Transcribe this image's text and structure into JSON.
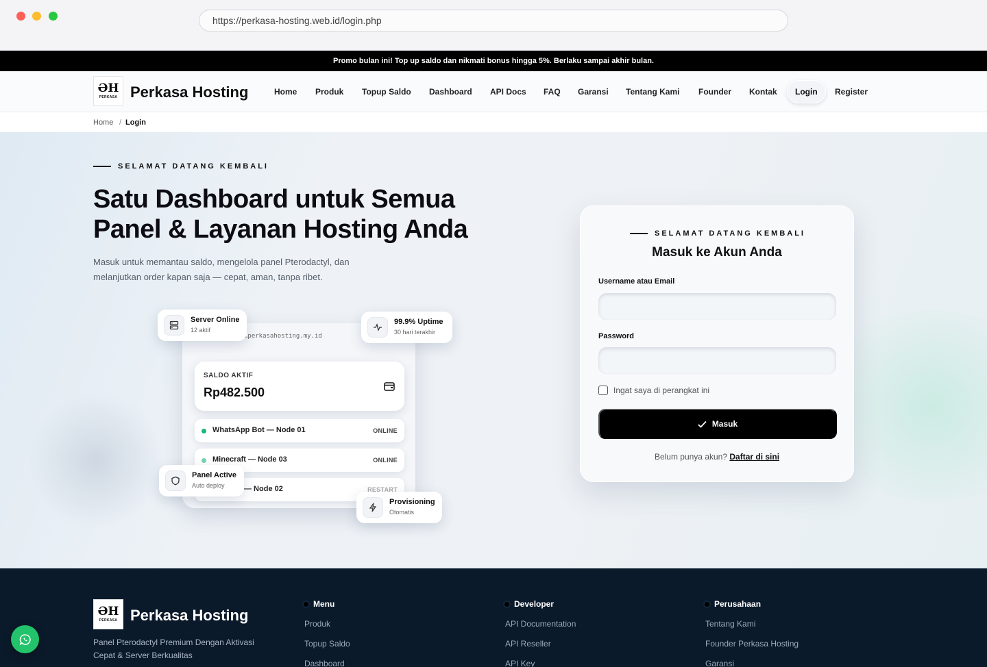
{
  "browser": {
    "url": "https://perkasa-hosting.web.id/login.php"
  },
  "promo": "Promo bulan ini! Top up saldo dan nikmati bonus hingga 5%. Berlaku sampai akhir bulan.",
  "brand": {
    "name": "Perkasa Hosting",
    "logo_mark": "ƏH",
    "logo_sub": "PERKASA"
  },
  "nav": {
    "home": "Home",
    "produk": "Produk",
    "topup": "Topup Saldo",
    "dashboard": "Dashboard",
    "api": "API Docs",
    "faq": "FAQ",
    "garansi": "Garansi",
    "tentang": "Tentang Kami",
    "founder": "Founder",
    "kontak": "Kontak",
    "login": "Login",
    "register": "Register"
  },
  "breadcrumb": {
    "home": "Home",
    "sep": "/",
    "current": "Login"
  },
  "hero": {
    "eyebrow": "SELAMAT DATANG KEMBALI",
    "title": "Satu Dashboard untuk Semua Panel & Layanan Hosting Anda",
    "desc": "Masuk untuk memantau saldo, mengelola panel Pterodactyl, dan melanjutkan order kapan saja — cepat, aman, tanpa ribet."
  },
  "illustration": {
    "url": "…perkasahosting.my.id",
    "saldo_label": "SALDO AKTIF",
    "saldo_value": "Rp482.500",
    "rows": [
      {
        "name": "WhatsApp Bot — Node 01",
        "status": "ONLINE"
      },
      {
        "name": "Minecraft — Node 03",
        "status": "ONLINE"
      },
      {
        "name": "— Node 02",
        "status": "RESTART"
      }
    ],
    "floats": {
      "server": {
        "title": "Server Online",
        "sub": "12 aktif"
      },
      "uptime": {
        "title": "99.9% Uptime",
        "sub": "30 hari terakhir"
      },
      "panel": {
        "title": "Panel Active",
        "sub": "Auto deploy"
      },
      "prov": {
        "title": "Provisioning",
        "sub": "Otomatis"
      }
    }
  },
  "login": {
    "eyebrow": "SELAMAT DATANG KEMBALI",
    "title": "Masuk ke Akun Anda",
    "username_label": "Username atau Email",
    "username_value": "",
    "password_label": "Password",
    "password_value": "",
    "remember": "Ingat saya di perangkat ini",
    "submit": "Masuk",
    "foot_text": "Belum punya akun?",
    "foot_link": "Daftar di sini"
  },
  "footer": {
    "desc": "Panel Pterodactyl Premium Dengan Aktivasi Cepat & Server Berkualitas",
    "cols": [
      {
        "title": "Menu",
        "links": [
          "Produk",
          "Topup Saldo",
          "Dashboard"
        ]
      },
      {
        "title": "Developer",
        "links": [
          "API Documentation",
          "API Reseller",
          "API Key"
        ]
      },
      {
        "title": "Perusahaan",
        "links": [
          "Tentang Kami",
          "Founder Perkasa Hosting",
          "Garansi"
        ]
      }
    ]
  },
  "colors": {
    "accent": "#000000",
    "online": "#18b87a",
    "whatsapp": "#22c36a",
    "footer_bg": "#0b1a2b"
  }
}
